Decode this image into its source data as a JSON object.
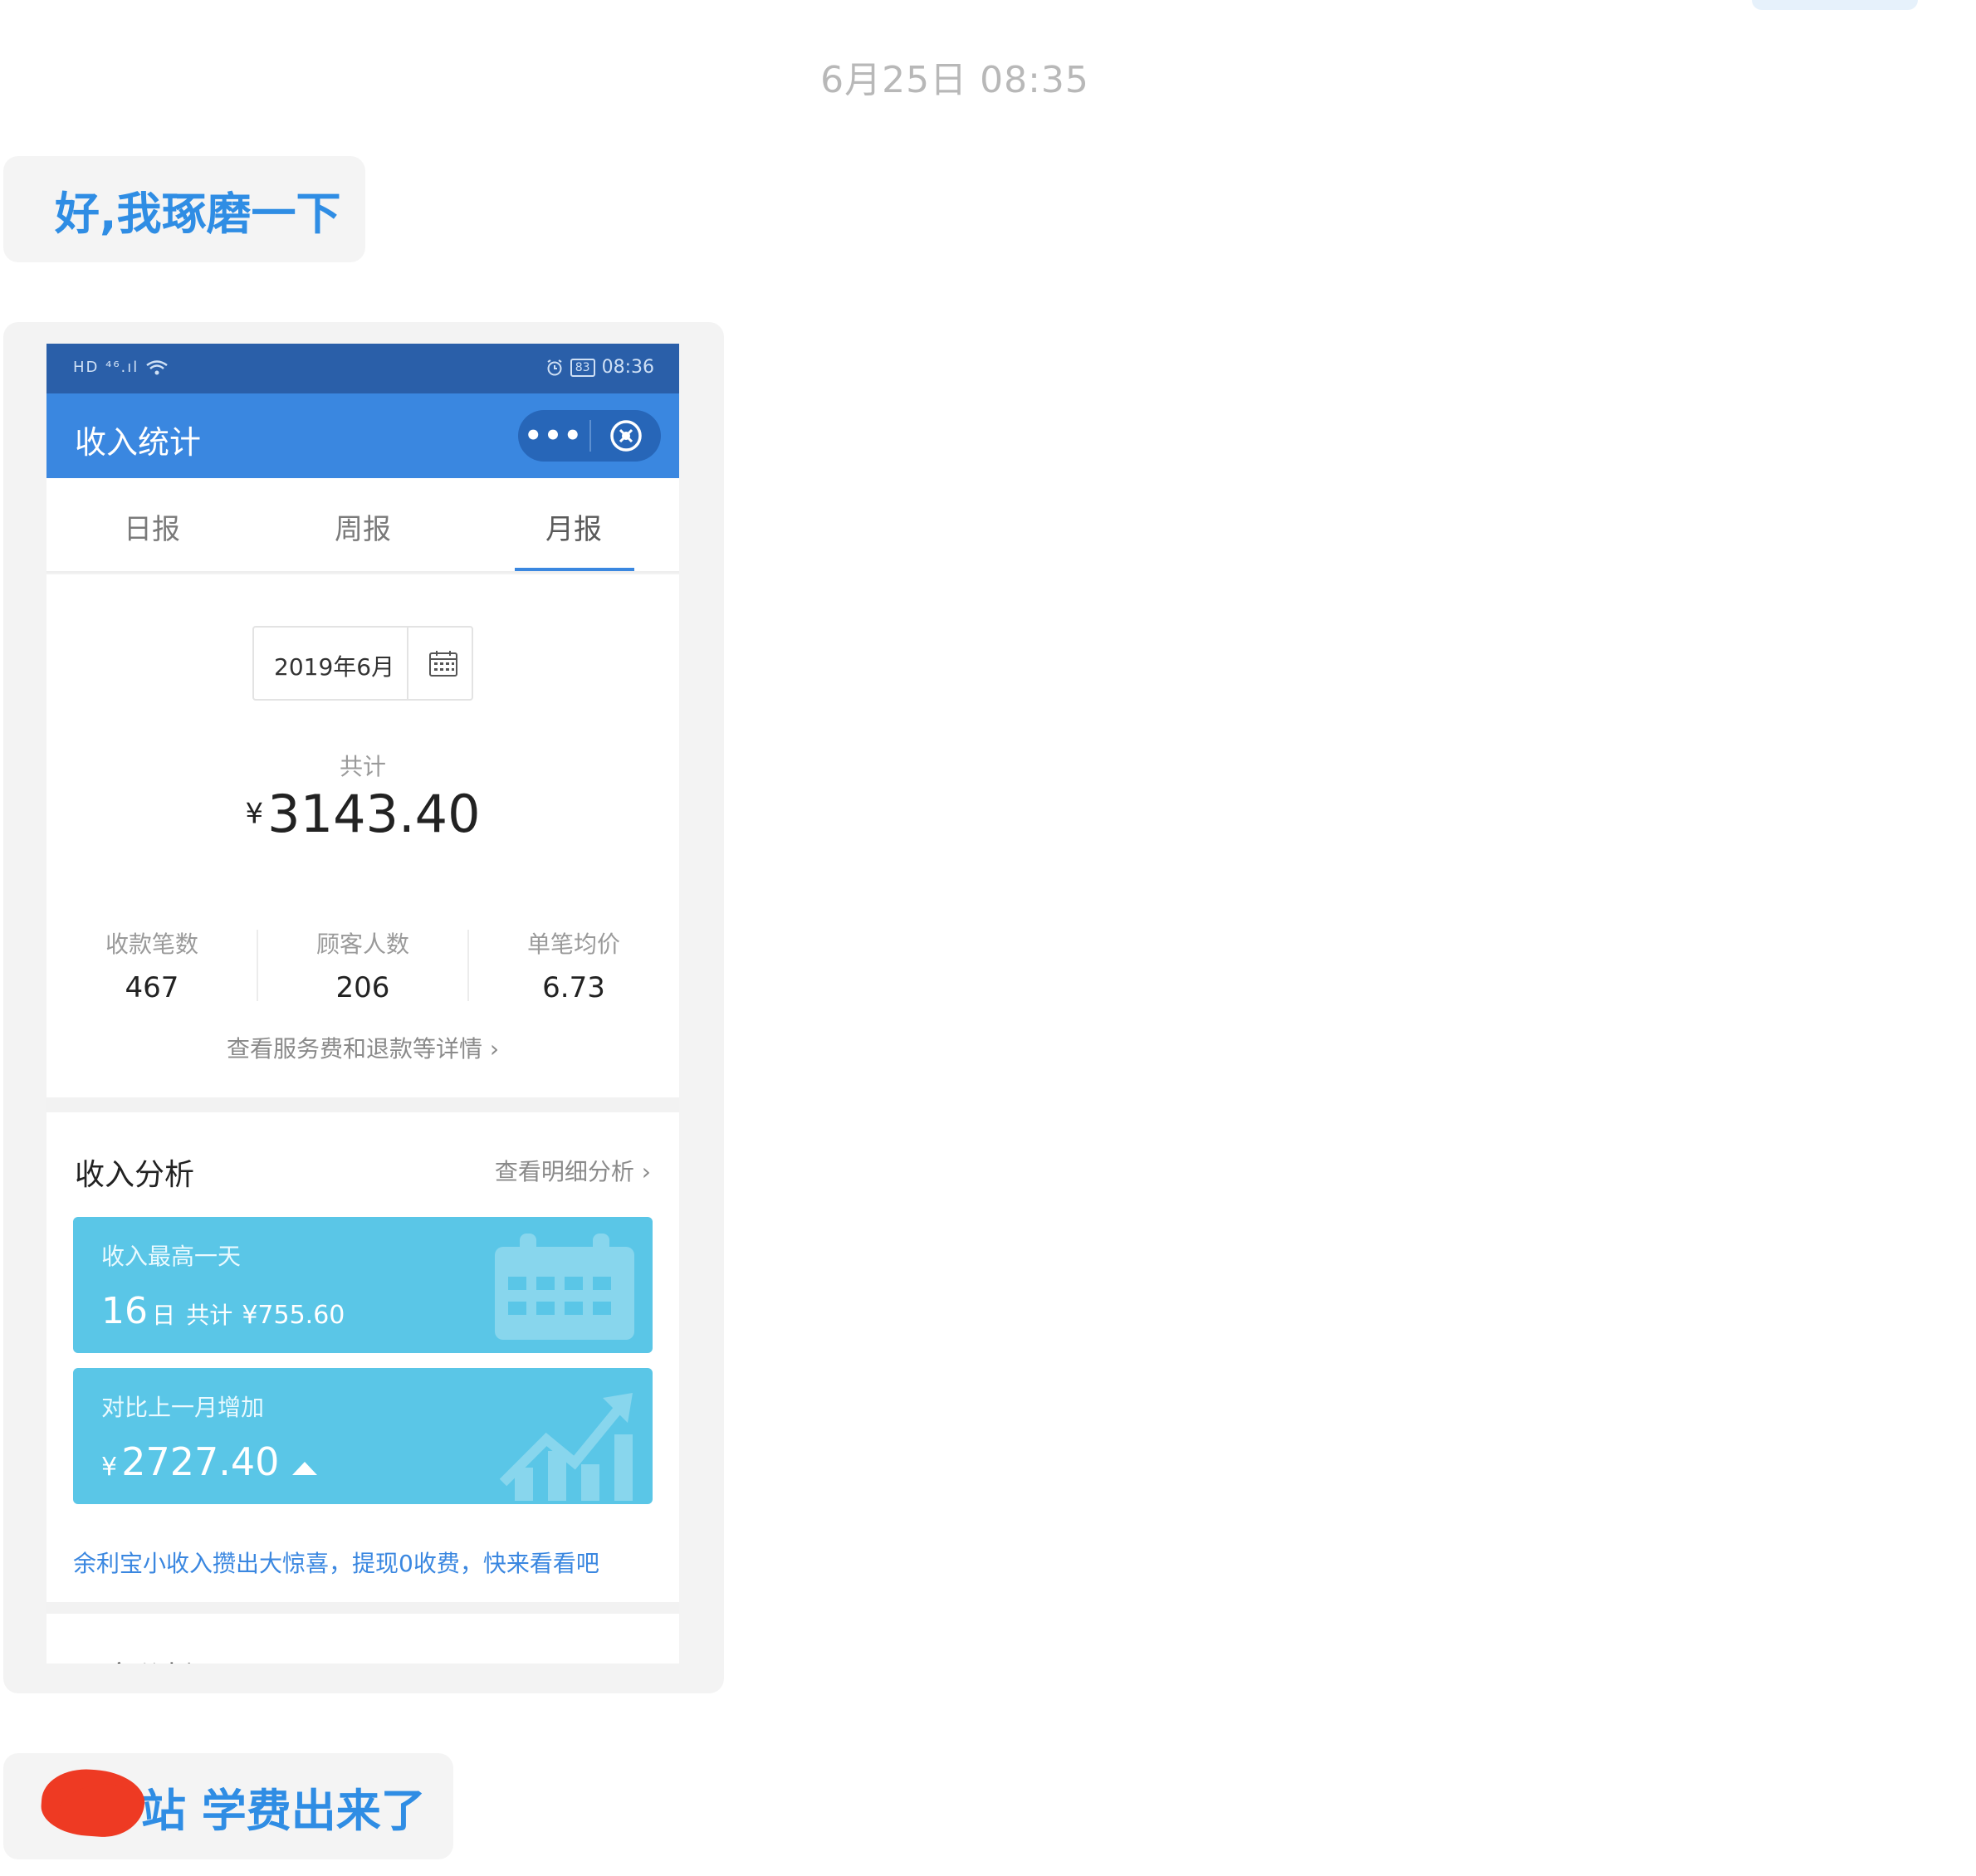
{
  "chat": {
    "timestamp": "6月25日  08:35",
    "message_1": "好,我琢磨一下",
    "message_3": "站 学费出来了"
  },
  "screenshot": {
    "status_bar": {
      "left_indicators": "HD ⁴⁶.ıl",
      "time": "08:36",
      "battery": "83"
    },
    "nav": {
      "title": "收入统计",
      "more": "•••"
    },
    "tabs": [
      {
        "label": "日报",
        "active": false
      },
      {
        "label": "周报",
        "active": false
      },
      {
        "label": "月报",
        "active": true
      }
    ],
    "summary": {
      "date": "2019年6月",
      "total_label": "共计",
      "currency": "¥",
      "total": "3143.40",
      "stats": [
        {
          "label": "收款笔数",
          "value": "467"
        },
        {
          "label": "顾客人数",
          "value": "206"
        },
        {
          "label": "单笔均价",
          "value": "6.73"
        }
      ],
      "detail_link": "查看服务费和退款等详情 ›"
    },
    "analysis": {
      "title": "收入分析",
      "link": "查看明细分析 ›",
      "card_best": {
        "label": "收入最高一天",
        "day": "16",
        "day_unit": "日",
        "total_label": "共计",
        "amount": "¥755.60"
      },
      "card_compare": {
        "label": "对比上一月增加",
        "currency": "¥",
        "amount": "2727.40"
      },
      "promo": "余利宝小收入攒出大惊喜，提现0收费，快来看看吧"
    },
    "customer": {
      "title": "顾客分析"
    }
  },
  "colors": {
    "chat_text": "#2f8de4",
    "nav_blue": "#3a87e0",
    "status_blue": "#2a5fa9",
    "card_cyan": "#5ac6e7",
    "redaction": "#ee3a23"
  }
}
